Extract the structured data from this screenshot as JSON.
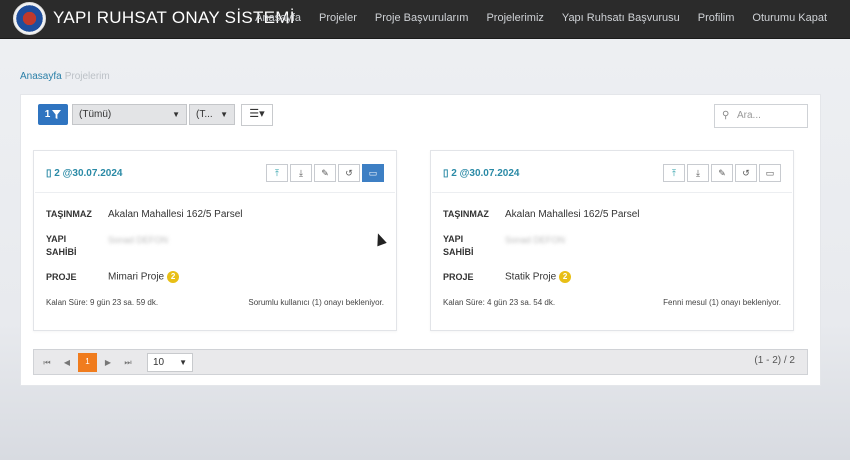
{
  "header": {
    "brand": "YAPI RUHSAT ONAY SİSTEMİ",
    "nav": [
      "Anasayfa",
      "Projeler",
      "Proje Başvurularım",
      "Projelerimiz",
      "Yapı Ruhsatı Başvurusu",
      "Profilim",
      "Oturumu Kapat"
    ]
  },
  "breadcrumb": {
    "home": "Anasayfa",
    "current": "Projelerim"
  },
  "toolbar": {
    "filter_count": "1",
    "select1": "(Tümü)",
    "select2": "(T...",
    "search_placeholder": "Ara..."
  },
  "cards": [
    {
      "title": "2 @30.07.2024",
      "tasinmaz_label": "TAŞINMAZ",
      "tasinmaz": "Akalan Mahallesi 162/5 Parsel",
      "yapi_sahibi_label_1": "YAPI",
      "yapi_sahibi_label_2": "SAHİBİ",
      "yapi_sahibi": "Sonad DEFON",
      "proje_label": "PROJE",
      "proje": "Mimari Proje",
      "proje_count": "2",
      "remaining": "Kalan Süre: 9 gün 23 sa. 59 dk.",
      "status": "Sorumlu kullanıcı (1) onayı bekleniyor."
    },
    {
      "title": "2 @30.07.2024",
      "tasinmaz_label": "TAŞINMAZ",
      "tasinmaz": "Akalan Mahallesi 162/5 Parsel",
      "yapi_sahibi_label_1": "YAPI",
      "yapi_sahibi_label_2": "SAHİBİ",
      "yapi_sahibi": "Sonad DEFON",
      "proje_label": "PROJE",
      "proje": "Statik Proje",
      "proje_count": "2",
      "remaining": "Kalan Süre: 4 gün 23 sa. 54 dk.",
      "status": "Fenni mesul (1) onayı bekleniyor."
    }
  ],
  "pager": {
    "first": "⏮",
    "prev": "◀",
    "current": "1",
    "next": "▶",
    "last": "⏭",
    "page_size": "10",
    "info": "(1 - 2) / 2"
  },
  "colors": {
    "nav_bg": "#2b2b2b",
    "accent": "#2a8aa6",
    "primary": "#2f74c0",
    "page_active": "#f07c1e",
    "badge": "#e8bf16"
  },
  "icons": [
    "filter-icon",
    "list-icon",
    "search-icon",
    "building-icon",
    "upload-icon",
    "download-icon",
    "edit-icon",
    "history-icon",
    "monitor-icon"
  ]
}
